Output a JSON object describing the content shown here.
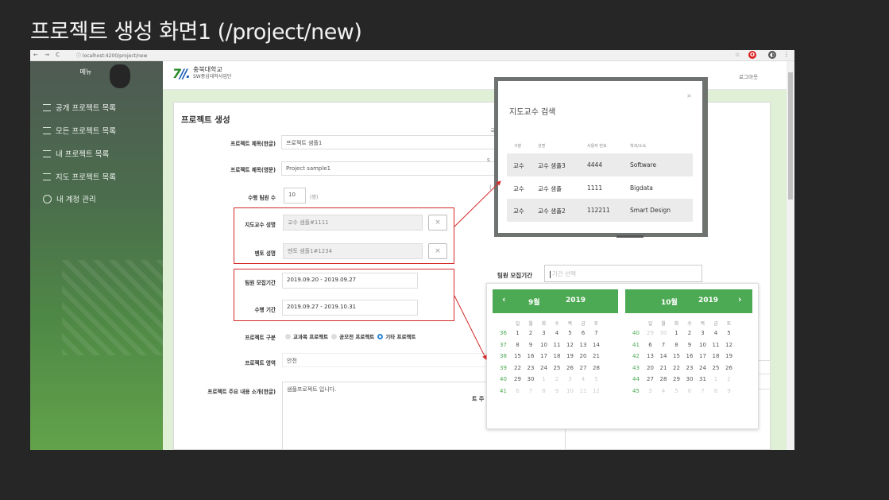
{
  "slide_title": "프로젝트 생성 화면1 (/project/new)",
  "browser": {
    "nav_icons": "← → C",
    "url": "ⓘ localhost:4200/project/new",
    "star": "☆",
    "ext1": "O",
    "ext2": "◐",
    "menu": "⋮"
  },
  "sidebar": {
    "title": "메뉴",
    "items": [
      {
        "label": "공개 프로젝트 목록",
        "icon": "list-icon"
      },
      {
        "label": "모든 프로젝트 목록",
        "icon": "list-icon"
      },
      {
        "label": "내 프로젝트 목록",
        "icon": "list-icon"
      },
      {
        "label": "지도 프로젝트 목록",
        "icon": "list-icon"
      },
      {
        "label": "내 계정 관리",
        "icon": "user-icon"
      }
    ]
  },
  "header": {
    "logo_mark": "7",
    "logo_mark2": "//.",
    "org_name": "충북대학교",
    "org_sub": "SW중심대학사업단",
    "logout": "로그아웃"
  },
  "form": {
    "title": "프로젝트 생성",
    "title_kr_label": "프로젝트 제목(한글)",
    "title_kr_value": "프로젝트 샘플1",
    "title_en_label": "프로젝트 제목(영문)",
    "title_en_value": "Project sample1",
    "team_count_label": "수행 팀원 수",
    "team_count_value": "10",
    "team_count_unit": "(명)",
    "advisor_label": "지도교수 성명",
    "advisor_value": "교수 샘플#1111",
    "mentor_label": "멘토 성명",
    "mentor_value": "멘토 샘플1#1234",
    "recruit_label": "팀원 모집기간",
    "recruit_value": "2019.09.20 - 2019.09.27",
    "period_label": "수행 기간",
    "period_value": "2019.09.27 - 2019.10.31",
    "category_label": "프로젝트 구분",
    "category_options": [
      "교과목 프로젝트",
      "공모전 프로젝트",
      "기타 프로젝트"
    ],
    "category_selected": "기타 프로젝트",
    "area_label": "프로젝트 영역",
    "area_value": "안전",
    "intro_label": "프로젝트 주요 내용 소개(한글)",
    "intro_value": "샘플프로젝트 입니다.",
    "clear": "×",
    "trunc_intro": "트 주",
    "trunc_s": "s",
    "trunc_paren": "(",
    "trunc_kor": "국"
  },
  "advisor_modal": {
    "title": "지도교수 검색",
    "close": "×",
    "columns": [
      "구분",
      "성명",
      "사용자 번호",
      "학과/소속"
    ],
    "rows": [
      [
        "교수",
        "교수 샘플3",
        "4444",
        "Software"
      ],
      [
        "교수",
        "교수 샘플",
        "1111",
        "Bigdata"
      ],
      [
        "교수",
        "교수 샘플2",
        "112211",
        "Smart Design"
      ]
    ]
  },
  "datepicker": {
    "label": "팀원 모집기간",
    "placeholder": "기간 선택",
    "prev": "‹",
    "next": "›",
    "left": {
      "month": "9월",
      "year": "2019",
      "weekdays": [
        "일",
        "월",
        "화",
        "수",
        "목",
        "금",
        "토"
      ],
      "weeks": [
        {
          "num": "36",
          "days": [
            "1",
            "2",
            "3",
            "4",
            "5",
            "6",
            "7"
          ],
          "muted": [
            false,
            false,
            false,
            false,
            false,
            false,
            false
          ]
        },
        {
          "num": "37",
          "days": [
            "8",
            "9",
            "10",
            "11",
            "12",
            "13",
            "14"
          ],
          "muted": [
            false,
            false,
            false,
            false,
            false,
            false,
            false
          ]
        },
        {
          "num": "38",
          "days": [
            "15",
            "16",
            "17",
            "18",
            "19",
            "20",
            "21"
          ],
          "muted": [
            false,
            false,
            false,
            false,
            false,
            false,
            false
          ]
        },
        {
          "num": "39",
          "days": [
            "22",
            "23",
            "24",
            "25",
            "26",
            "27",
            "28"
          ],
          "muted": [
            false,
            false,
            false,
            false,
            false,
            false,
            false
          ]
        },
        {
          "num": "40",
          "days": [
            "29",
            "30",
            "1",
            "2",
            "3",
            "4",
            "5"
          ],
          "muted": [
            false,
            false,
            true,
            true,
            true,
            true,
            true
          ]
        },
        {
          "num": "41",
          "days": [
            "6",
            "7",
            "8",
            "9",
            "10",
            "11",
            "12"
          ],
          "muted": [
            true,
            true,
            true,
            true,
            true,
            true,
            true
          ]
        }
      ]
    },
    "right": {
      "month": "10월",
      "year": "2019",
      "weekdays": [
        "일",
        "월",
        "화",
        "수",
        "목",
        "금",
        "토"
      ],
      "weeks": [
        {
          "num": "40",
          "days": [
            "29",
            "30",
            "1",
            "2",
            "3",
            "4",
            "5"
          ],
          "muted": [
            true,
            true,
            false,
            false,
            false,
            false,
            false
          ]
        },
        {
          "num": "41",
          "days": [
            "6",
            "7",
            "8",
            "9",
            "10",
            "11",
            "12"
          ],
          "muted": [
            false,
            false,
            false,
            false,
            false,
            false,
            false
          ]
        },
        {
          "num": "42",
          "days": [
            "13",
            "14",
            "15",
            "16",
            "17",
            "18",
            "19"
          ],
          "muted": [
            false,
            false,
            false,
            false,
            false,
            false,
            false
          ]
        },
        {
          "num": "43",
          "days": [
            "20",
            "21",
            "22",
            "23",
            "24",
            "25",
            "26"
          ],
          "muted": [
            false,
            false,
            false,
            false,
            false,
            false,
            false
          ]
        },
        {
          "num": "44",
          "days": [
            "27",
            "28",
            "29",
            "30",
            "31",
            "1",
            "2"
          ],
          "muted": [
            false,
            false,
            false,
            false,
            false,
            true,
            true
          ]
        },
        {
          "num": "45",
          "days": [
            "3",
            "4",
            "5",
            "6",
            "7",
            "8",
            "9"
          ],
          "muted": [
            true,
            true,
            true,
            true,
            true,
            true,
            true
          ]
        }
      ]
    }
  },
  "colors": {
    "accent_green": "#4daa54",
    "highlight_red": "#d32a2a",
    "radio_selected": "#2b86d9"
  }
}
